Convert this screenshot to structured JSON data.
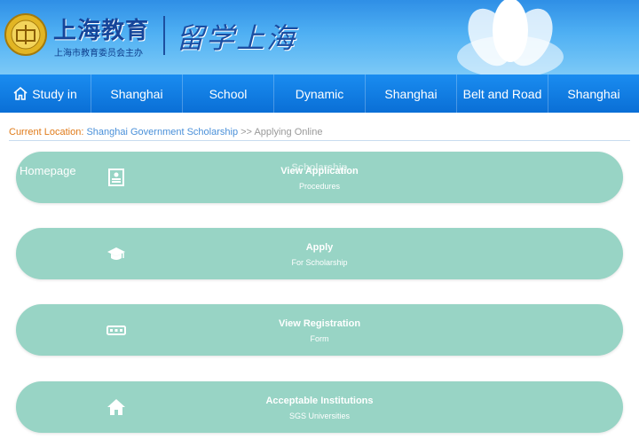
{
  "header": {
    "logo_cn": "上海教育",
    "logo_sub": "上海市教育委员会主办",
    "title": "留学上海"
  },
  "nav": {
    "items": [
      {
        "label": "Study in",
        "icon": "home-icon"
      },
      {
        "label": "Shanghai"
      },
      {
        "label": "School"
      },
      {
        "label": "Dynamic"
      },
      {
        "label": "Shanghai"
      },
      {
        "label": "Belt and Road"
      },
      {
        "label": "Shanghai"
      }
    ]
  },
  "location": {
    "label": "Current Location:",
    "link": "Shanghai Government Scholarship",
    "separator": ">>",
    "current": "Applying Online"
  },
  "homepage_label": "Homepage",
  "cards": [
    {
      "icon": "document-icon",
      "ghost": "Scholarship",
      "title": "View Application",
      "subtitle": "Procedures"
    },
    {
      "icon": "graduation-cap-icon",
      "title": "Apply",
      "subtitle": "For Scholarship"
    },
    {
      "icon": "keyboard-icon",
      "title": "View Registration",
      "subtitle": "Form"
    },
    {
      "icon": "home-icon",
      "title": "Acceptable Institutions",
      "subtitle": "SGS Universities"
    }
  ],
  "colors": {
    "card": "#98d4c5",
    "nav": "#0a6fd6",
    "location_label": "#e07a18",
    "location_link": "#4a90d9"
  }
}
